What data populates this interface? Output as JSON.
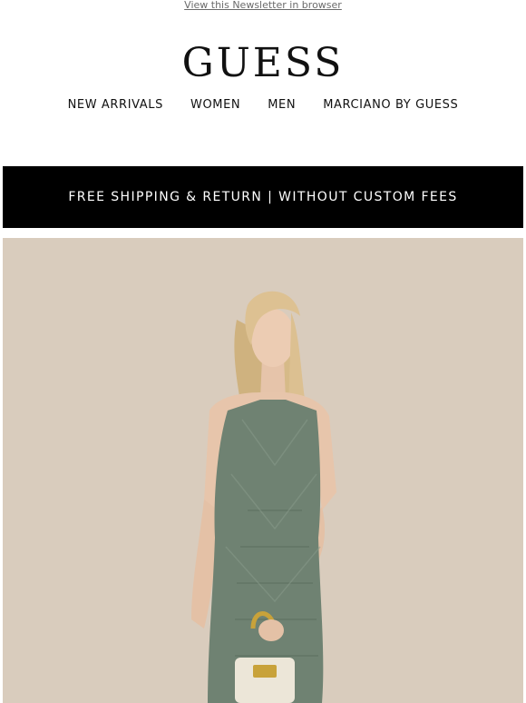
{
  "header": {
    "view_in_browser": "View this Newsletter in browser",
    "logo": "GUESS"
  },
  "nav": {
    "items": [
      "NEW ARRIVALS",
      "WOMEN",
      "MEN",
      "MARCIANO BY GUESS"
    ]
  },
  "banner": {
    "text": "FREE SHIPPING & RETURN | WITHOUT CUSTOM FEES"
  },
  "hero": {
    "icon": "model-photo",
    "colors": {
      "background": "#d9ccbd",
      "dress": "#6f8272",
      "hair": "#d8bd8c",
      "skin": "#e8c7ae"
    }
  },
  "colors": {
    "banner_bg": "#000000",
    "banner_text": "#ffffff"
  }
}
